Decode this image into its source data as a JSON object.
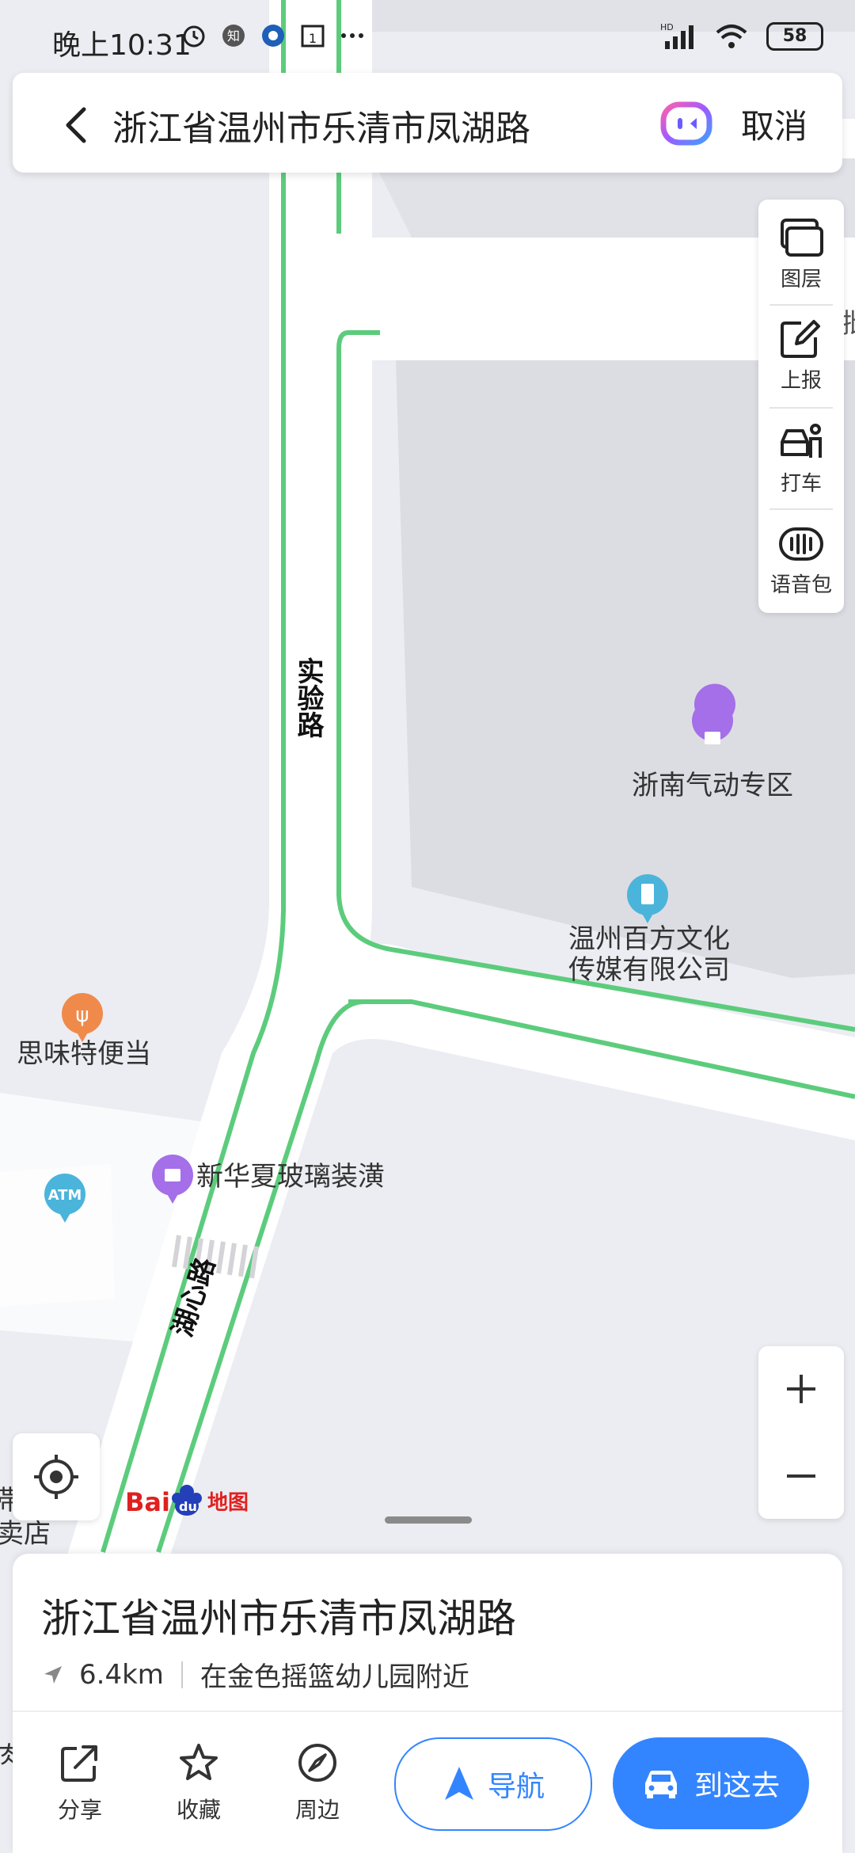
{
  "status_bar": {
    "time": "晚上10:31",
    "battery": "58",
    "signal_label": "HD"
  },
  "search": {
    "query": "浙江省温州市乐清市凤湖路",
    "cancel_label": "取消"
  },
  "tools": [
    {
      "label": "图层",
      "icon": "layers-icon"
    },
    {
      "label": "上报",
      "icon": "report-icon"
    },
    {
      "label": "打车",
      "icon": "taxi-icon"
    },
    {
      "label": "语音包",
      "icon": "voice-pack-icon"
    }
  ],
  "map_labels": {
    "road_shiyan": "实验路",
    "road_huxin": "湖心路",
    "poi_zhenan": "浙南气动专区",
    "poi_baifang_line1": "温州百方文化",
    "poi_baifang_line2": "传媒有限公司",
    "poi_siweite": "思味特便当",
    "poi_xinhuaxia": "新华夏玻璃装潢",
    "poi_atm": "ATM",
    "edge_text_1": "帯",
    "edge_text_2": "卖店",
    "edge_text_3": "肉",
    "edge_text_right": "批",
    "logo_bai": "Bai",
    "logo_du": "du",
    "logo_ditu": "地图"
  },
  "card": {
    "title": "浙江省温州市乐清市凤湖路",
    "distance": "6.4km",
    "nearby": "在金色摇篮幼儿园附近"
  },
  "actions": [
    {
      "label": "分享",
      "icon": "share-icon"
    },
    {
      "label": "收藏",
      "icon": "star-icon"
    },
    {
      "label": "周边",
      "icon": "compass-icon"
    }
  ],
  "buttons": {
    "navigate": "导航",
    "go_here": "到这去"
  },
  "colors": {
    "accent": "#3385ff",
    "road_border": "#5ccc7c",
    "poi_purple": "#a46fe8",
    "poi_blue": "#4bb4db",
    "poi_orange": "#f08a4b"
  }
}
